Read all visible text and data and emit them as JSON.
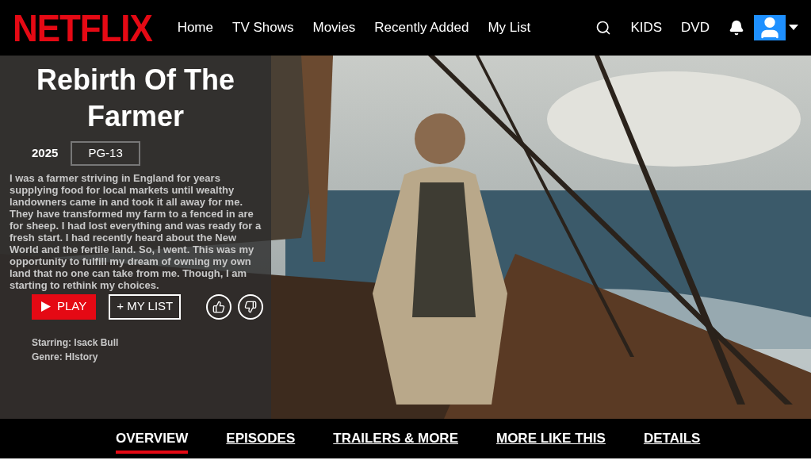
{
  "header": {
    "logo": "NETFLIX",
    "nav": [
      {
        "label": "Home"
      },
      {
        "label": "TV Shows"
      },
      {
        "label": "Movies"
      },
      {
        "label": "Recently Added"
      },
      {
        "label": "My List"
      }
    ],
    "right_links": [
      {
        "label": "KIDS"
      },
      {
        "label": "DVD"
      }
    ]
  },
  "hero": {
    "title": "Rebirth Of The Farmer",
    "year": "2025",
    "rating": "PG-13",
    "description": "I was a farmer striving in England for years supplying food for local markets until wealthy landowners came in and took it all away for me. They have transformed my farm to a fenced in are for sheep. I had lost everything and was ready for a fresh start. I had recently heard about the New World and the fertile land. So, I went. This was my opportunity to fulfill my dream of owning my own land that no one can take from me. Though, I am starting to rethink my choices.",
    "play_label": "PLAY",
    "list_label": "+ MY LIST",
    "starring": "Starring: Isack Bull",
    "genre": "Genre: HIstory"
  },
  "tabs": [
    {
      "label": "OVERVIEW",
      "selected": true
    },
    {
      "label": "EPISODES",
      "selected": false
    },
    {
      "label": "TRAILERS & MORE",
      "selected": false
    },
    {
      "label": "MORE LIKE THIS",
      "selected": false
    },
    {
      "label": "DETAILS",
      "selected": false
    }
  ]
}
